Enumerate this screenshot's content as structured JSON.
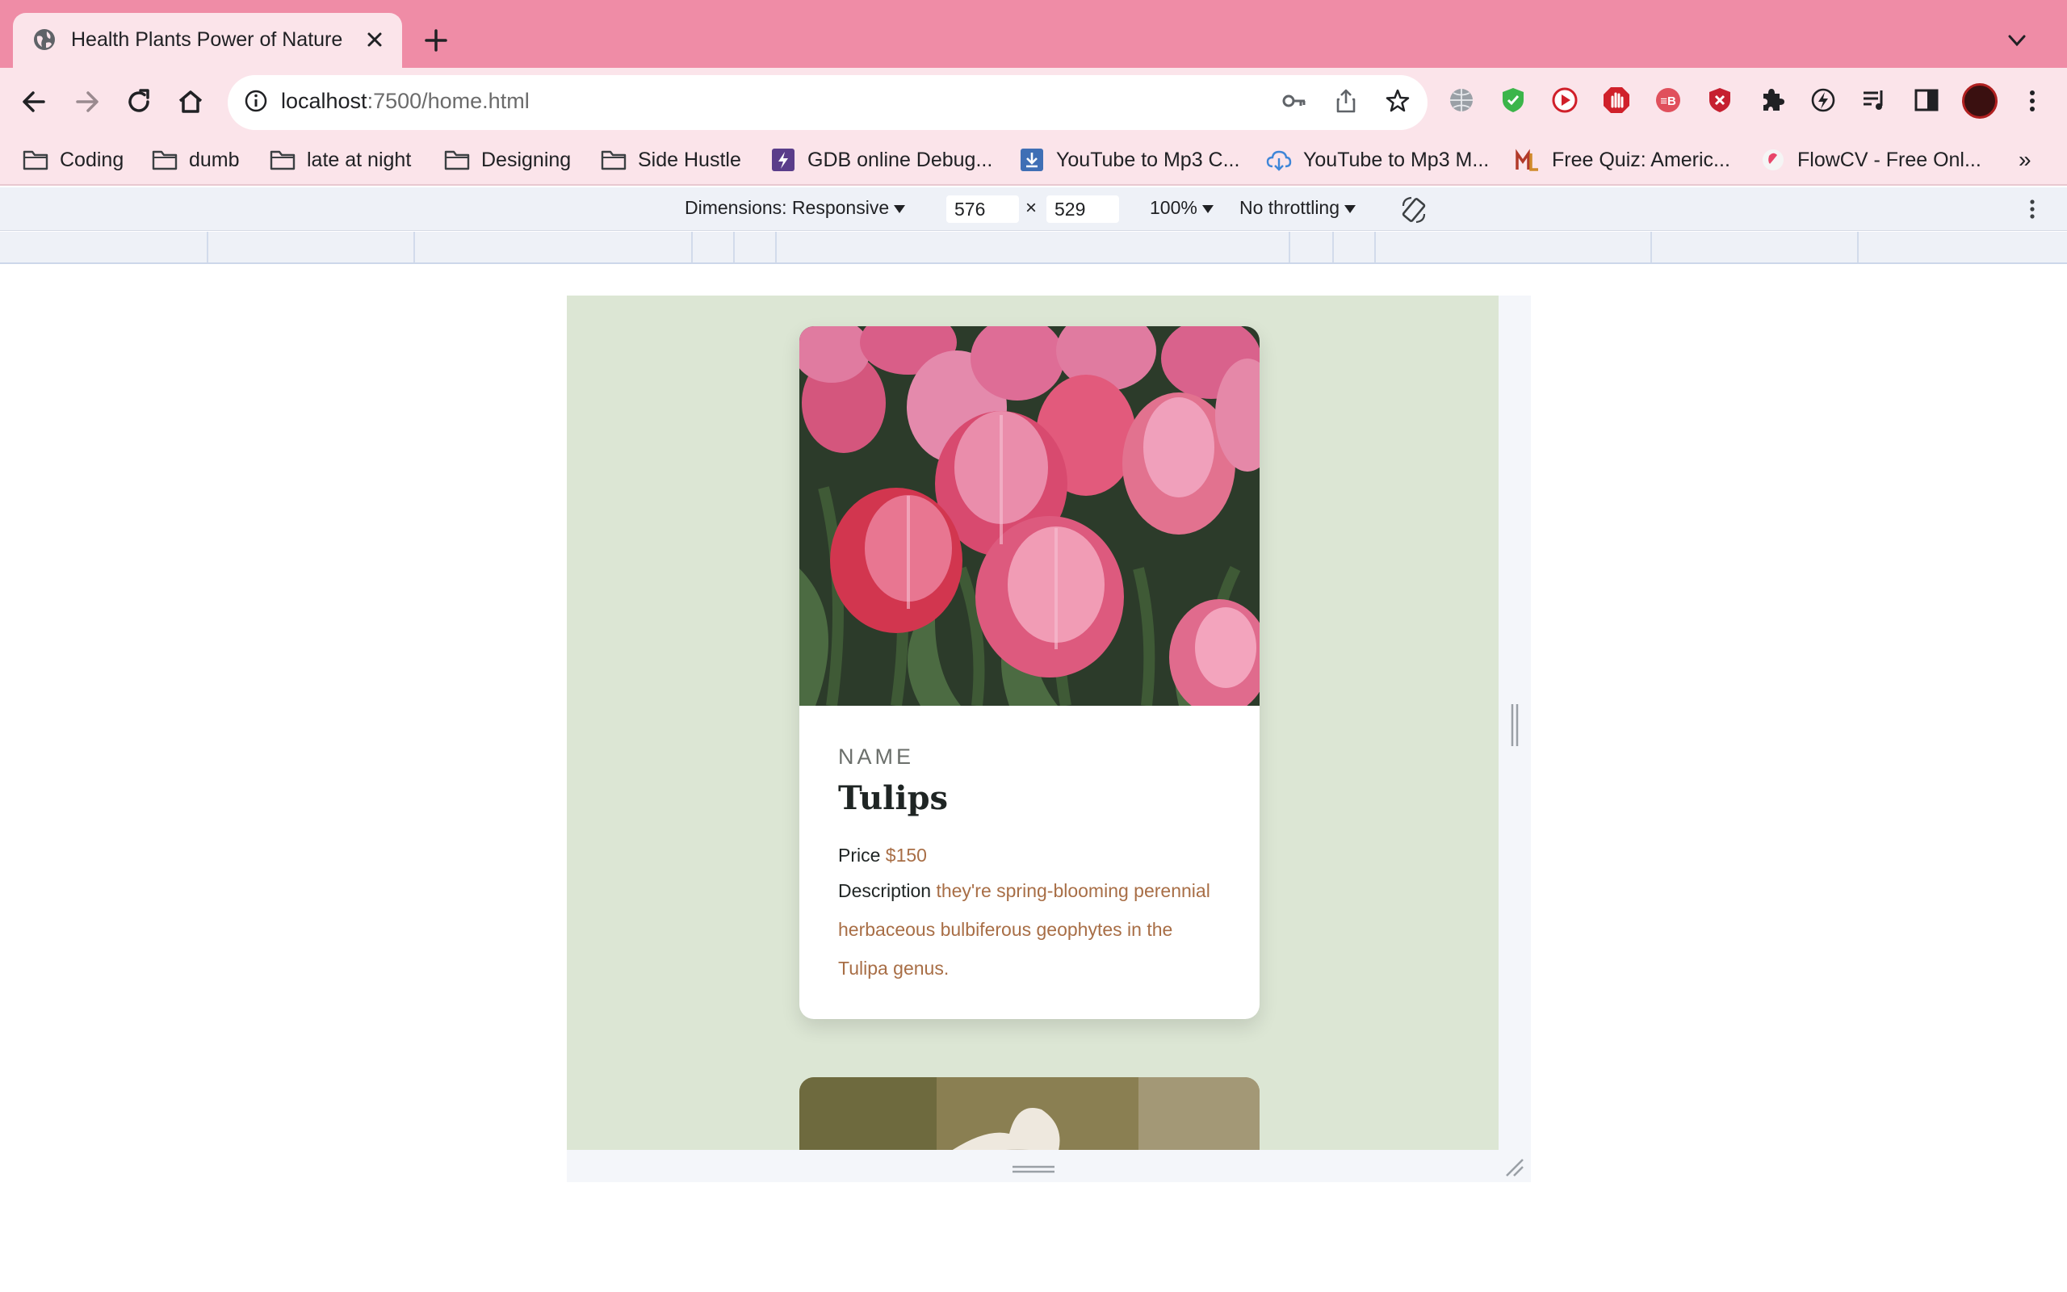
{
  "browser": {
    "tab": {
      "title": "Health Plants Power of Nature"
    },
    "url": {
      "host": "localhost",
      "path": ":7500/home.html"
    }
  },
  "bookmarks": [
    {
      "label": "Coding",
      "icon": "folder-icon"
    },
    {
      "label": "dumb",
      "icon": "folder-icon"
    },
    {
      "label": "late at night",
      "icon": "folder-icon"
    },
    {
      "label": "Designing",
      "icon": "folder-icon"
    },
    {
      "label": "Side Hustle",
      "icon": "folder-icon"
    },
    {
      "label": "GDB online Debug...",
      "icon": "gdb-icon"
    },
    {
      "label": "YouTube to Mp3 C...",
      "icon": "download-icon"
    },
    {
      "label": "YouTube to Mp3 M...",
      "icon": "cloud-download-icon"
    },
    {
      "label": "Free Quiz: Americ...",
      "icon": "quiz-icon"
    },
    {
      "label": "FlowCV - Free Onl...",
      "icon": "flowcv-icon"
    }
  ],
  "bookmarks_overflow": "»",
  "devtools": {
    "dimensions_label": "Dimensions: Responsive",
    "width": "576",
    "height": "529",
    "separator": "×",
    "zoom": "100%",
    "throttling": "No throttling"
  },
  "card": {
    "label": "NAME",
    "title": "Tulips",
    "price_label": "Price",
    "price_value": "$150",
    "description_label": "Description",
    "description_value": "they're spring-blooming perennial herbaceous bulbiferous geophytes in the Tulipa genus."
  },
  "colors": {
    "tabstrip": "#ef8ca6",
    "toolbar": "#fbe4ea",
    "page_background": "#dce6d4",
    "accent_text": "#a86e46"
  }
}
